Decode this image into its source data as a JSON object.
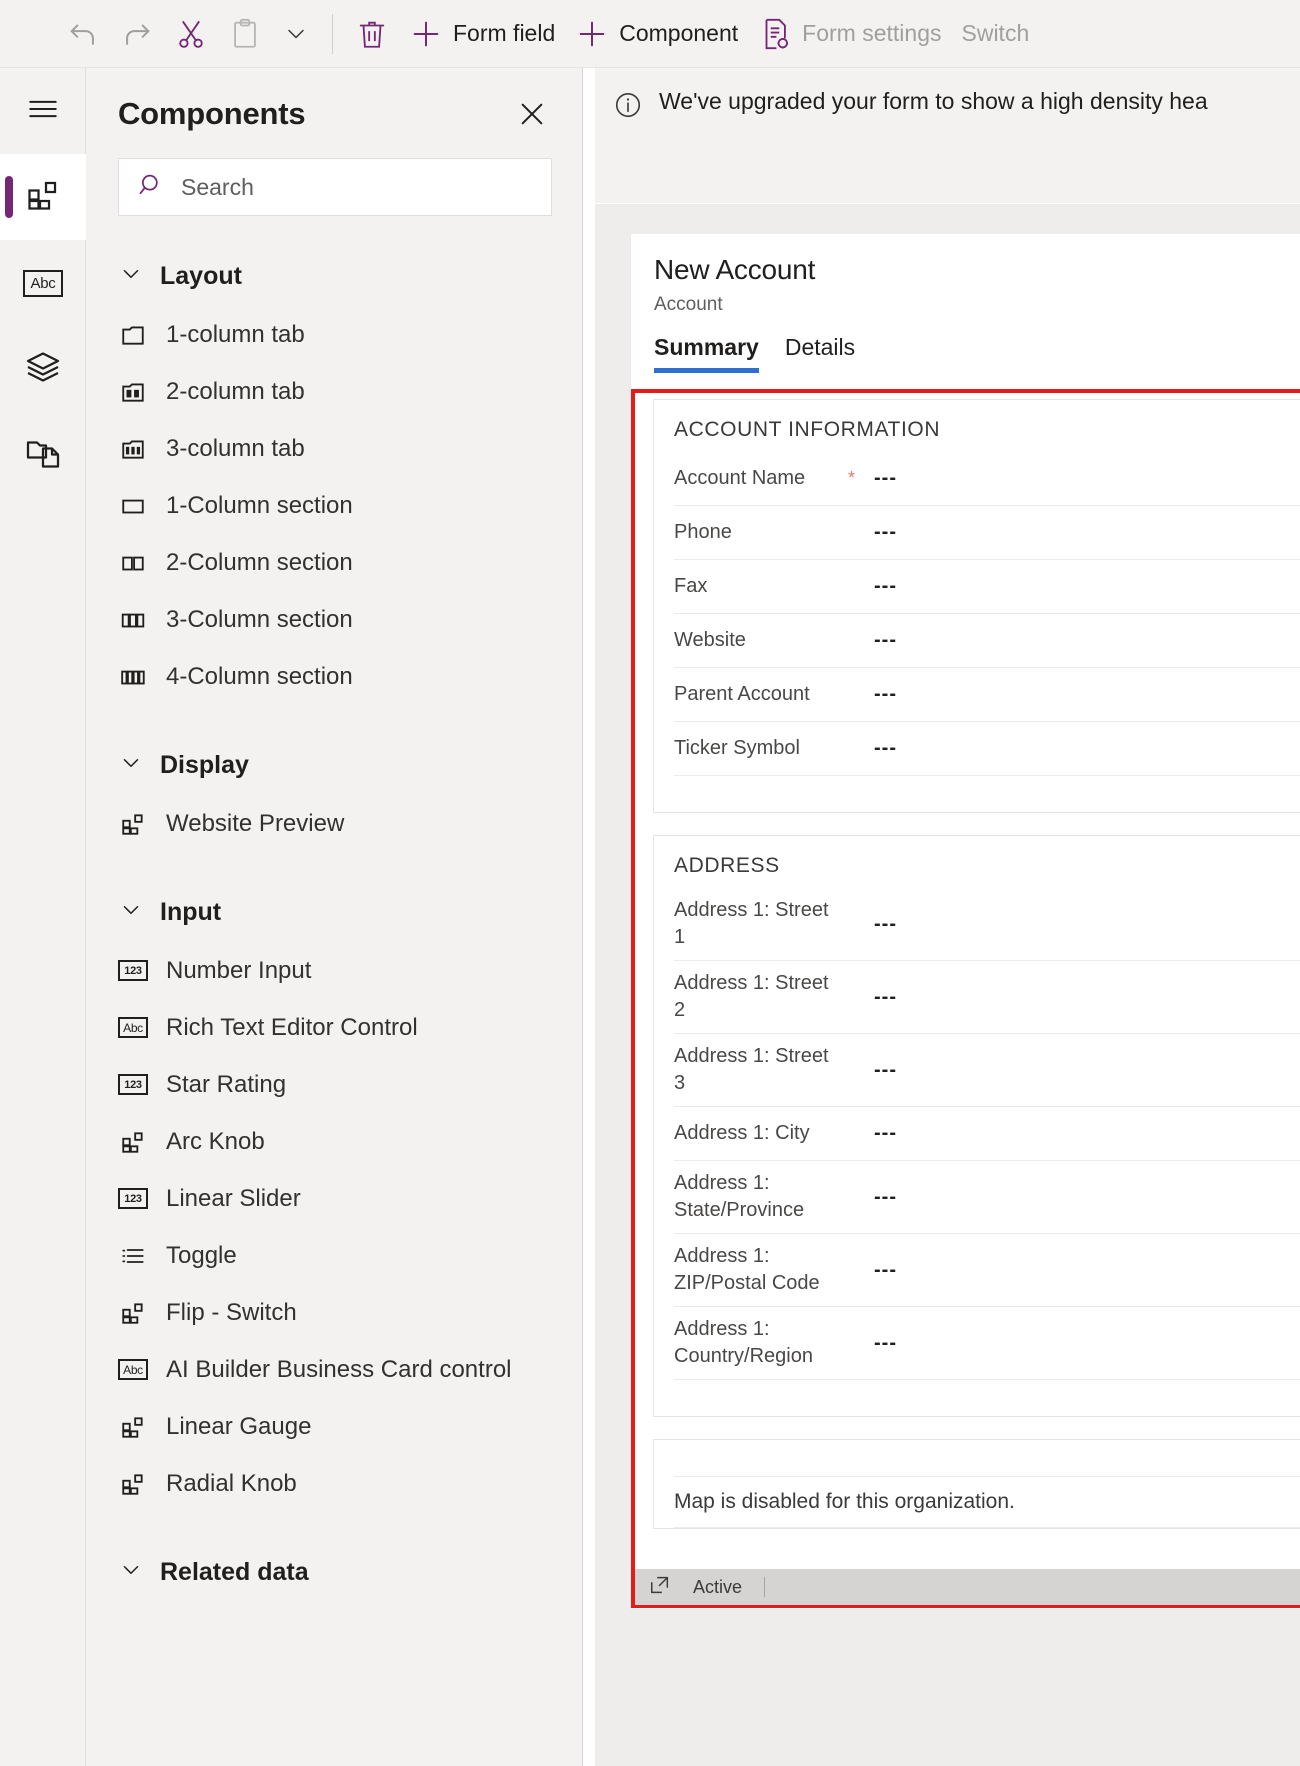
{
  "toolbar": {
    "items": [
      {
        "name": "undo",
        "label": "",
        "icon": "undo-icon",
        "disabled": true
      },
      {
        "name": "redo",
        "label": "",
        "icon": "redo-icon",
        "disabled": true
      },
      {
        "name": "cut",
        "label": "",
        "icon": "scissors-icon",
        "disabled": false
      },
      {
        "name": "paste",
        "label": "",
        "icon": "clipboard-icon",
        "disabled": true
      },
      {
        "name": "paste-more",
        "label": "",
        "icon": "chevron-down-icon",
        "disabled": false
      },
      {
        "name": "delete",
        "label": "",
        "icon": "trash-icon",
        "disabled": false
      },
      {
        "name": "form-field",
        "label": "Form field",
        "icon": "plus-icon",
        "disabled": false
      },
      {
        "name": "component",
        "label": "Component",
        "icon": "plus-icon",
        "disabled": false
      },
      {
        "name": "form-settings",
        "label": "Form settings",
        "icon": "form-settings-icon",
        "disabled": true
      },
      {
        "name": "switch",
        "label": "Switch",
        "icon": "",
        "disabled": true
      }
    ]
  },
  "rail": {
    "items": [
      {
        "name": "hamburger-menu",
        "icon": "hamburger-icon",
        "selected": false
      },
      {
        "name": "components",
        "icon": "components-icon",
        "selected": true
      },
      {
        "name": "fields",
        "icon": "abc-icon",
        "selected": false
      },
      {
        "name": "layers",
        "icon": "layers-icon",
        "selected": false
      },
      {
        "name": "copy",
        "icon": "copy-pages-icon",
        "selected": false
      }
    ]
  },
  "panel": {
    "title": "Components",
    "close_label": "Close",
    "search": {
      "placeholder": "Search",
      "value": ""
    },
    "groups": [
      {
        "title": "Layout",
        "expanded": true,
        "items": [
          {
            "label": "1-column tab",
            "icon": "tab-1col-icon"
          },
          {
            "label": "2-column tab",
            "icon": "tab-2col-icon"
          },
          {
            "label": "3-column tab",
            "icon": "tab-3col-icon"
          },
          {
            "label": "1-Column section",
            "icon": "section-1col-icon"
          },
          {
            "label": "2-Column section",
            "icon": "section-2col-icon"
          },
          {
            "label": "3-Column section",
            "icon": "section-3col-icon"
          },
          {
            "label": "4-Column section",
            "icon": "section-4col-icon"
          }
        ]
      },
      {
        "title": "Display",
        "expanded": true,
        "items": [
          {
            "label": "Website Preview",
            "icon": "component-icon"
          }
        ]
      },
      {
        "title": "Input",
        "expanded": true,
        "items": [
          {
            "label": "Number Input",
            "icon": "number-icon"
          },
          {
            "label": "Rich Text Editor Control",
            "icon": "abc-icon"
          },
          {
            "label": "Star Rating",
            "icon": "number-icon"
          },
          {
            "label": "Arc Knob",
            "icon": "component-icon"
          },
          {
            "label": "Linear Slider",
            "icon": "number-icon"
          },
          {
            "label": "Toggle",
            "icon": "list-icon"
          },
          {
            "label": "Flip - Switch",
            "icon": "component-icon"
          },
          {
            "label": "AI Builder Business Card control",
            "icon": "abc-icon"
          },
          {
            "label": "Linear Gauge",
            "icon": "component-icon"
          },
          {
            "label": "Radial Knob",
            "icon": "component-icon"
          }
        ]
      },
      {
        "title": "Related data",
        "expanded": true,
        "items": []
      }
    ]
  },
  "canvas": {
    "notification": {
      "icon": "info-icon",
      "text": "We've upgraded your form to show a high density hea"
    },
    "form": {
      "title": "New Account",
      "subtitle": "Account",
      "tabs": [
        {
          "label": "Summary",
          "active": true
        },
        {
          "label": "Details",
          "active": false
        }
      ],
      "sections": [
        {
          "title": "ACCOUNT INFORMATION",
          "fields": [
            {
              "label": "Account Name",
              "required": true,
              "value": "---"
            },
            {
              "label": "Phone",
              "required": false,
              "value": "---"
            },
            {
              "label": "Fax",
              "required": false,
              "value": "---"
            },
            {
              "label": "Website",
              "required": false,
              "value": "---"
            },
            {
              "label": "Parent Account",
              "required": false,
              "value": "---"
            },
            {
              "label": "Ticker Symbol",
              "required": false,
              "value": "---"
            }
          ]
        },
        {
          "title": "ADDRESS",
          "fields": [
            {
              "label": "Address 1: Street 1",
              "required": false,
              "value": "---"
            },
            {
              "label": "Address 1: Street 2",
              "required": false,
              "value": "---"
            },
            {
              "label": "Address 1: Street 3",
              "required": false,
              "value": "---"
            },
            {
              "label": "Address 1: City",
              "required": false,
              "value": "---"
            },
            {
              "label": "Address 1: State/Province",
              "required": false,
              "value": "---"
            },
            {
              "label": "Address 1: ZIP/Postal Code",
              "required": false,
              "value": "---"
            },
            {
              "label": "Address 1: Country/Region",
              "required": false,
              "value": "---"
            }
          ]
        }
      ],
      "map_message": "Map is disabled for this organization.",
      "status": {
        "icon": "popout-icon",
        "text": "Active"
      }
    }
  },
  "colors": {
    "accent_purple": "#742774",
    "tab_underline": "#2f6fd0",
    "selection_red": "#e31b1b",
    "required_star": "#e8796b",
    "panel_bg": "#f3f2f1"
  },
  "required_marker": "*"
}
